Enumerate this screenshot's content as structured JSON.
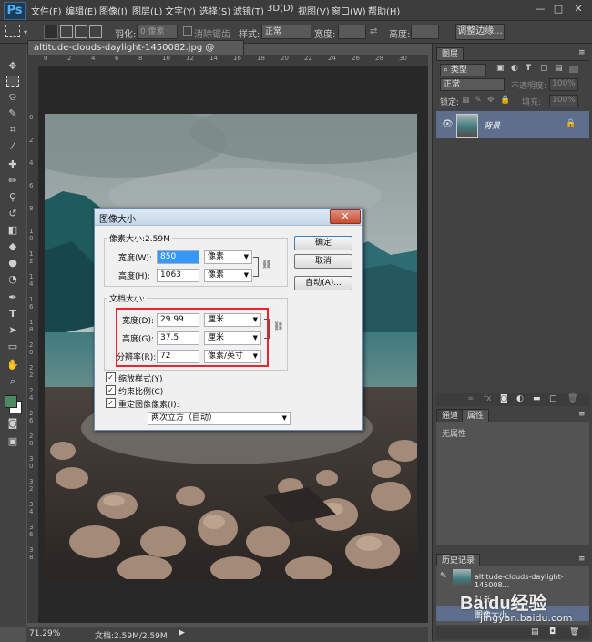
{
  "menubar": {
    "logo": "Ps",
    "items": [
      "文件(F)",
      "编辑(E)",
      "图像(I)",
      "图层(L)",
      "文字(Y)",
      "选择(S)",
      "滤镜(T)",
      "3D(D)",
      "视图(V)",
      "窗口(W)",
      "帮助(H)"
    ],
    "window_buttons": [
      "—",
      "□",
      "✕"
    ]
  },
  "options": {
    "feather_label": "羽化:",
    "feather_value": "0 像素",
    "antialias_label": "消除锯齿",
    "style_label": "样式:",
    "style_value": "正常",
    "width_label": "宽度:",
    "height_label": "高度:",
    "refine_button": "调整边缘..."
  },
  "document": {
    "tab_title": "altitude-clouds-daylight-1450082.jpg @ 71.3%(RGB/8) *",
    "tab_close": "×",
    "zoom": "71.29%",
    "doc_info": "文档:2.59M/2.59M",
    "ruler_top": [
      "0",
      "2",
      "4",
      "6",
      "8",
      "10",
      "12",
      "14",
      "16",
      "18",
      "20",
      "22",
      "24",
      "26",
      "28",
      "30"
    ],
    "ruler_left": [
      "0",
      "2",
      "4",
      "6",
      "8",
      "1 0",
      "1 2",
      "1 4",
      "1 6",
      "1 8",
      "2 0",
      "2 2",
      "2 4",
      "2 6",
      "2 8",
      "3 0",
      "3 2",
      "3 4",
      "3 6",
      "3 8"
    ]
  },
  "layers_panel": {
    "tab": "图层",
    "filter_label": "类型",
    "blend_mode": "正常",
    "opacity_label": "不透明度:",
    "opacity_value": "100%",
    "lock_label": "锁定:",
    "fill_label": "填充:",
    "fill_value": "100%",
    "layer_name": "背景"
  },
  "props_panel": {
    "tab_channels": "通道",
    "tab_properties": "属性",
    "no_properties": "无属性"
  },
  "history_panel": {
    "tab": "历史记录",
    "snapshot_name": "altitude-clouds-daylight-145008...",
    "item_open": "打开",
    "item_image_size": "图像大小"
  },
  "watermark": {
    "brand": "Baidu经验",
    "url": "jingyan.baidu.com"
  },
  "dialog": {
    "title": "图像大小",
    "close": "✕",
    "pixel_dim_label": "像素大小:2.59M",
    "px_width_label": "宽度(W):",
    "px_width_value": "850",
    "px_width_unit": "像素",
    "px_height_label": "高度(H):",
    "px_height_value": "1063",
    "px_height_unit": "像素",
    "doc_size_label": "文档大小:",
    "doc_width_label": "宽度(D):",
    "doc_width_value": "29.99",
    "doc_width_unit": "厘米",
    "doc_height_label": "高度(G):",
    "doc_height_value": "37.5",
    "doc_height_unit": "厘米",
    "resolution_label": "分辨率(R):",
    "resolution_value": "72",
    "resolution_unit": "像素/英寸",
    "scale_styles": "缩放样式(Y)",
    "constrain": "约束比例(C)",
    "resample": "重定图像像素(I):",
    "resample_method": "两次立方（自动）",
    "ok": "确定",
    "cancel": "取消",
    "auto": "自动(A)..."
  },
  "colors": {
    "highlight_red": "#e8242f",
    "fg_swatch": "#4a8a5e",
    "bg_swatch": "#ffffff"
  }
}
